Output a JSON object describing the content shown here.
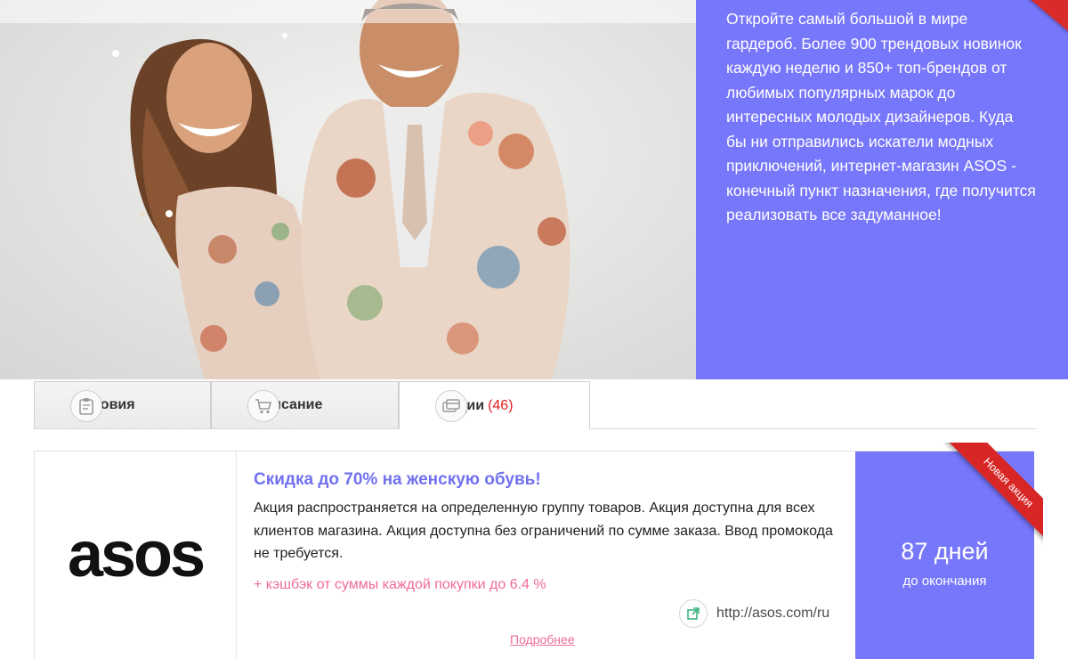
{
  "hero": {
    "description": "Откройте самый большой в мире гардероб. Более 900 трендовых новинок каждую неделю и 850+ топ-брендов от любимых популярных марок до интересных молодых дизайнеров. Куда бы ни отправились искатели модных приключений, интернет-магазин ASOS - конечный пункт назначения, где получится реализовать все задуманное!",
    "accent_color": "#7777fb"
  },
  "tabs": [
    {
      "label": "Условия",
      "icon": "clipboard-icon"
    },
    {
      "label": "Описание",
      "icon": "cart-icon"
    },
    {
      "label": "Акции",
      "count": "(46)",
      "icon": "cards-icon",
      "active": true
    }
  ],
  "offer": {
    "brand_logo": "asos",
    "title": "Скидка до 70% на женскую обувь!",
    "description": "Акция распространяется на определенную группу товаров. Акция доступна для всех клиентов магазина. Акция доступна без ограничений по сумме заказа. Ввод промокода не требуется.",
    "cashback": "+ кэшбэк от суммы каждой покупки до 6.4 %",
    "store_url": "http://asos.com/ru",
    "more_label": "Подробнее",
    "days_left": "87 дней",
    "days_caption": "до окончания",
    "ribbon": "Новая акция",
    "title_color": "#7171f0",
    "cashback_color": "#f06a9c",
    "ribbon_color": "#d82626"
  }
}
